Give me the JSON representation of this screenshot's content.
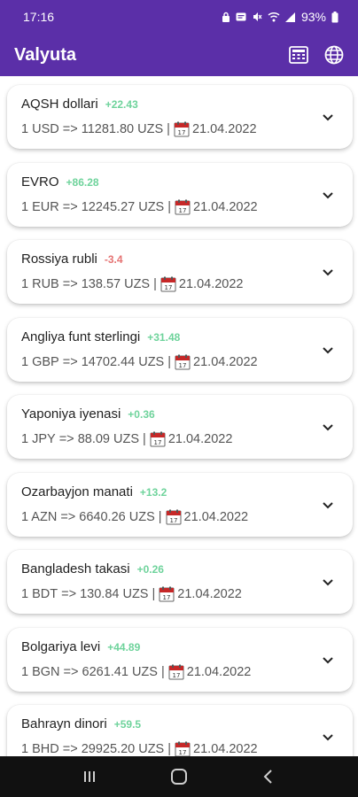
{
  "status_bar": {
    "time": "17:16",
    "battery": "93%",
    "icons": [
      "lock-icon",
      "notification-icon",
      "mute-icon",
      "wifi-icon",
      "signal-icon",
      "battery-icon"
    ]
  },
  "app_bar": {
    "title": "Valyuta",
    "actions": [
      "calculator-icon",
      "globe-icon"
    ],
    "color": "#5b2fa8"
  },
  "currencies": [
    {
      "name": "AQSH dollari",
      "change": "+22.43",
      "direction": "up",
      "unit": "1 USD",
      "rate": "11281.80 UZS",
      "date": "21.04.2022"
    },
    {
      "name": "EVRO",
      "change": "+86.28",
      "direction": "up",
      "unit": "1 EUR",
      "rate": "12245.27 UZS",
      "date": "21.04.2022"
    },
    {
      "name": "Rossiya rubli",
      "change": "-3.4",
      "direction": "down",
      "unit": "1 RUB",
      "rate": "138.57 UZS",
      "date": "21.04.2022"
    },
    {
      "name": "Angliya funt sterlingi",
      "change": "+31.48",
      "direction": "up",
      "unit": "1 GBP",
      "rate": "14702.44 UZS",
      "date": "21.04.2022"
    },
    {
      "name": "Yaponiya iyenasi",
      "change": "+0.36",
      "direction": "up",
      "unit": "1 JPY",
      "rate": "88.09 UZS",
      "date": "21.04.2022"
    },
    {
      "name": "Ozarbayjon manati",
      "change": "+13.2",
      "direction": "up",
      "unit": "1 AZN",
      "rate": "6640.26 UZS",
      "date": "21.04.2022"
    },
    {
      "name": "Bangladesh takasi",
      "change": "+0.26",
      "direction": "up",
      "unit": "1 BDT",
      "rate": "130.84 UZS",
      "date": "21.04.2022"
    },
    {
      "name": "Bolgariya levi",
      "change": "+44.89",
      "direction": "up",
      "unit": "1 BGN",
      "rate": "6261.41 UZS",
      "date": "21.04.2022"
    },
    {
      "name": "Bahrayn dinori",
      "change": "+59.5",
      "direction": "up",
      "unit": "1 BHD",
      "rate": "29925.20 UZS",
      "date": "21.04.2022"
    }
  ],
  "nav_bar": {
    "buttons": [
      "recents-icon",
      "home-icon",
      "back-icon"
    ]
  }
}
